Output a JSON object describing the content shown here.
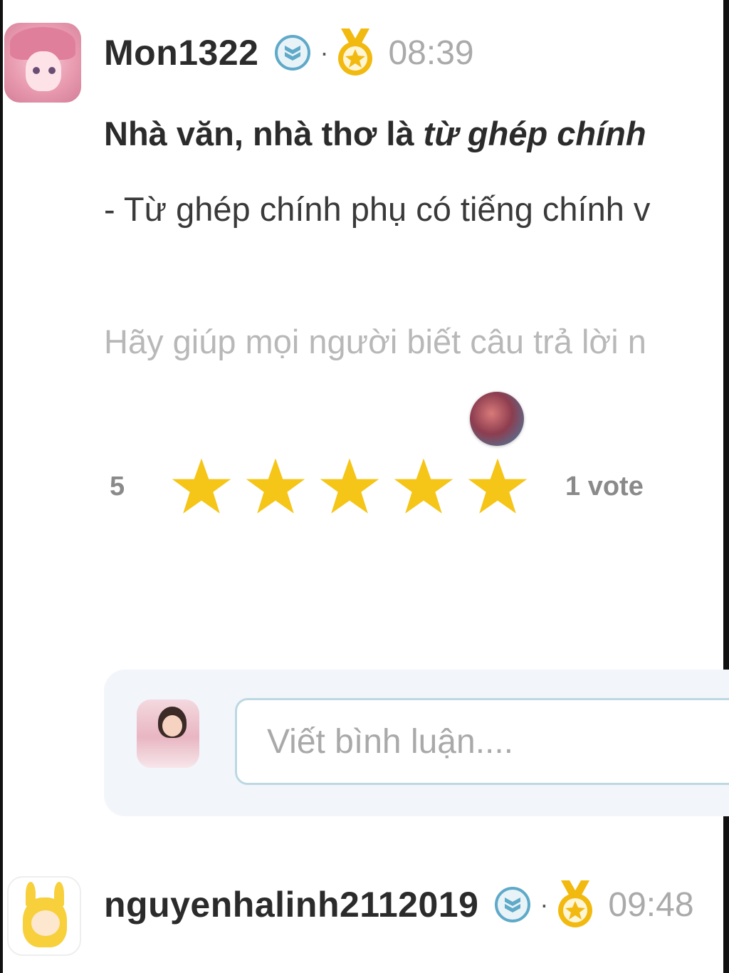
{
  "posts": [
    {
      "username": "Mon1322",
      "separator": "·",
      "time": "08:39",
      "rank_icon": "shield-rank-icon",
      "medal_icon": "gold-medal-icon",
      "answer_bold_prefix": "Nhà văn, nhà thơ là ",
      "answer_bold_italic": "từ ghép chính",
      "answer_line2": "- Từ ghép chính phụ có tiếng chính v",
      "help_text": "Hãy giúp mọi người biết câu trả lời n",
      "rating": {
        "value": "5",
        "stars_filled": 5,
        "stars_total": 5,
        "votes_label": "1 vote"
      }
    },
    {
      "username": "nguyenhalinh2112019",
      "separator": "·",
      "time": "09:48",
      "rank_icon": "shield-rank-icon",
      "medal_icon": "gold-medal-icon"
    }
  ],
  "comment": {
    "placeholder": "Viết bình luận...."
  },
  "colors": {
    "star": "#f5c518",
    "medal": "#f2b90f",
    "rank_badge": "#5fa9c9",
    "input_border": "#bcd8e2",
    "panel_bg": "#f2f5fa"
  }
}
